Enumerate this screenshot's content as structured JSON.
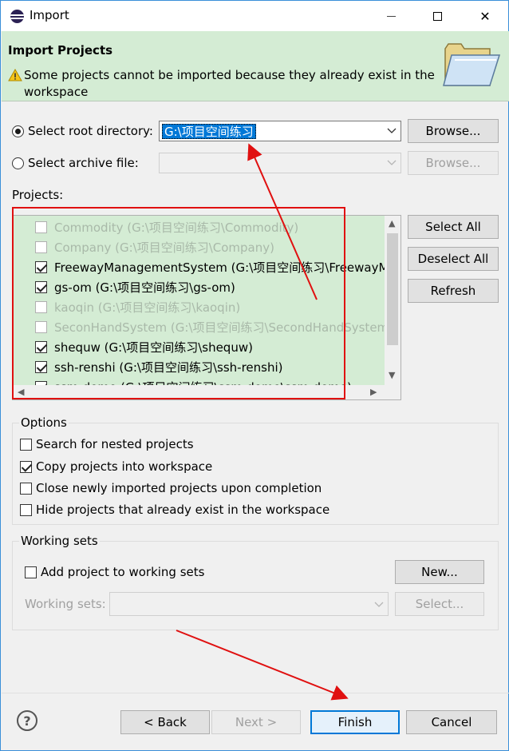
{
  "window": {
    "title": "Import",
    "controls": {
      "minimize": "—",
      "close": "✕"
    }
  },
  "banner": {
    "title": "Import Projects",
    "message": "Some projects cannot be imported because they already exist in the workspace",
    "warning_icon": "warning-icon",
    "image_icon": "folder-icon"
  },
  "source": {
    "root_label": "Select root directory:",
    "root_value": "G:\\项目空间练习",
    "root_selected": true,
    "archive_label": "Select archive file:",
    "archive_value": "",
    "browse_root": "Browse...",
    "browse_archive": "Browse..."
  },
  "projects": {
    "label": "Projects:",
    "items": [
      {
        "label": "Commodity (G:\\项目空间练习\\Commodity)",
        "checked": false,
        "enabled": false
      },
      {
        "label": "Company (G:\\项目空间练习\\Company)",
        "checked": false,
        "enabled": false
      },
      {
        "label": "FreewayManagementSystem (G:\\项目空间练习\\FreewayManagementSystem)",
        "checked": true,
        "enabled": true
      },
      {
        "label": "gs-om (G:\\项目空间练习\\gs-om)",
        "checked": true,
        "enabled": true
      },
      {
        "label": "kaoqin (G:\\项目空间练习\\kaoqin)",
        "checked": false,
        "enabled": false
      },
      {
        "label": "SeconHandSystem (G:\\项目空间练习\\SecondHandSystem-master)",
        "checked": false,
        "enabled": false
      },
      {
        "label": "shequw (G:\\项目空间练习\\shequw)",
        "checked": true,
        "enabled": true
      },
      {
        "label": "ssh-renshi (G:\\项目空间练习\\ssh-renshi)",
        "checked": true,
        "enabled": true
      },
      {
        "label": "ssm-demo (G:\\项目空间练习\\ssm-demo\\ssm-demo)",
        "checked": true,
        "enabled": true
      }
    ],
    "select_all": "Select All",
    "deselect_all": "Deselect All",
    "refresh": "Refresh"
  },
  "options": {
    "title": "Options",
    "items": [
      {
        "label": "Search for nested projects",
        "checked": false
      },
      {
        "label": "Copy projects into workspace",
        "checked": true
      },
      {
        "label": "Close newly imported projects upon completion",
        "checked": false
      },
      {
        "label": "Hide projects that already exist in the workspace",
        "checked": false
      }
    ]
  },
  "working_sets": {
    "title": "Working sets",
    "add_label": "Add project to working sets",
    "add_checked": false,
    "new_button": "New...",
    "sets_label": "Working sets:",
    "sets_value": "",
    "select_button": "Select..."
  },
  "footer": {
    "help_icon": "help-icon",
    "back": "< Back",
    "next": "Next >",
    "finish": "Finish",
    "cancel": "Cancel"
  },
  "colors": {
    "banner_bg": "#d4ecd4",
    "list_bg": "#d4ecd4",
    "selection": "#0078d7",
    "annotation": "#e01010"
  }
}
